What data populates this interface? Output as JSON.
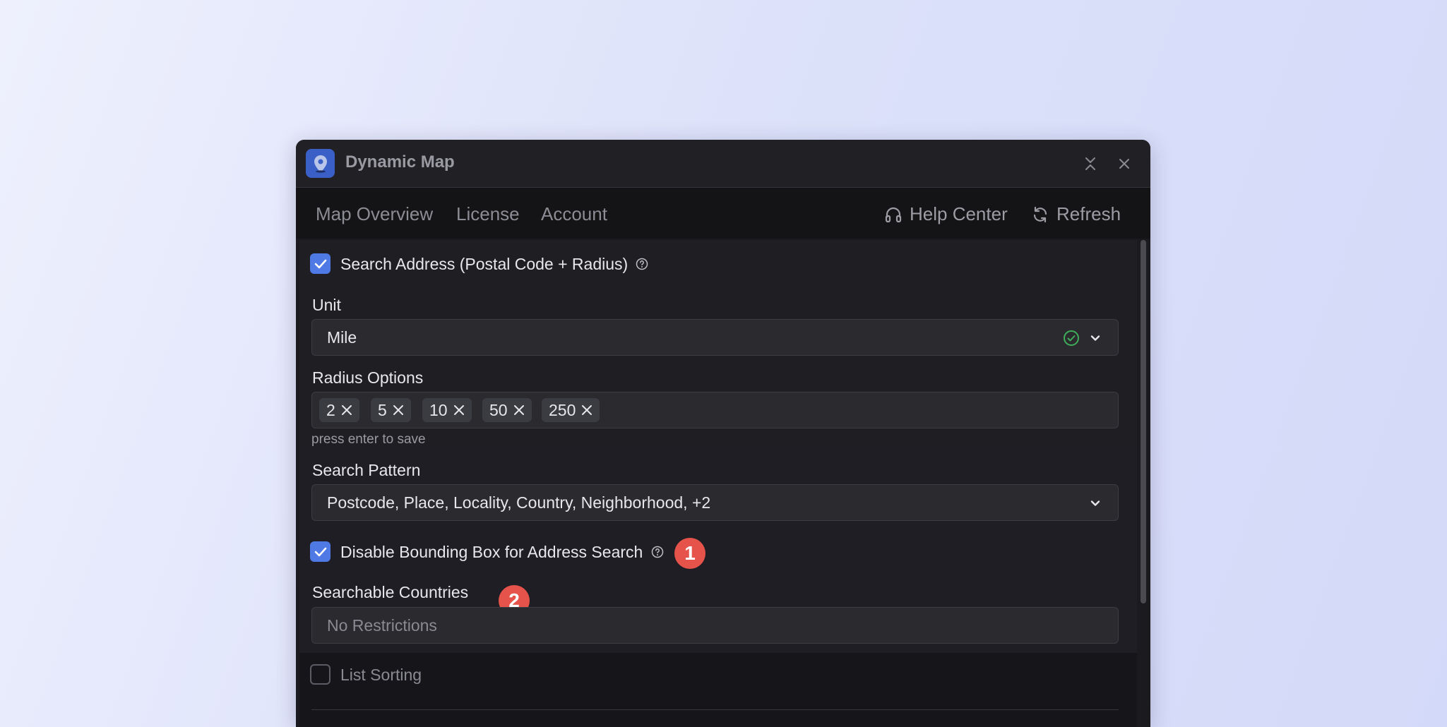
{
  "window": {
    "title": "Dynamic Map",
    "icon": "map-pin-icon",
    "controls": [
      "collapse-icon",
      "close-icon"
    ]
  },
  "nav": {
    "tabs": [
      {
        "label": "Map Overview"
      },
      {
        "label": "License"
      },
      {
        "label": "Account"
      }
    ],
    "help_label": "Help Center",
    "refresh_label": "Refresh"
  },
  "form": {
    "search_address": {
      "label": "Search Address (Postal Code + Radius)",
      "checked": true
    },
    "unit": {
      "label": "Unit",
      "value": "Mile"
    },
    "radius": {
      "label": "Radius Options",
      "tags": [
        "2",
        "5",
        "10",
        "50",
        "250"
      ],
      "hint": "press enter to save"
    },
    "search_pattern": {
      "label": "Search Pattern",
      "value": "Postcode, Place, Locality, Country, Neighborhood, +2"
    },
    "bounding_box": {
      "label": "Disable Bounding Box for Address Search",
      "checked": true
    },
    "countries": {
      "label": "Searchable Countries",
      "placeholder": "No Restrictions"
    },
    "list_sorting": {
      "label": "List Sorting",
      "checked": false
    }
  },
  "annotations": [
    "1",
    "2"
  ],
  "colors": {
    "accent": "#4f7ae6",
    "badge": "#e5534b",
    "success": "#3fae5a",
    "window_bg": "#1b1b1f"
  }
}
